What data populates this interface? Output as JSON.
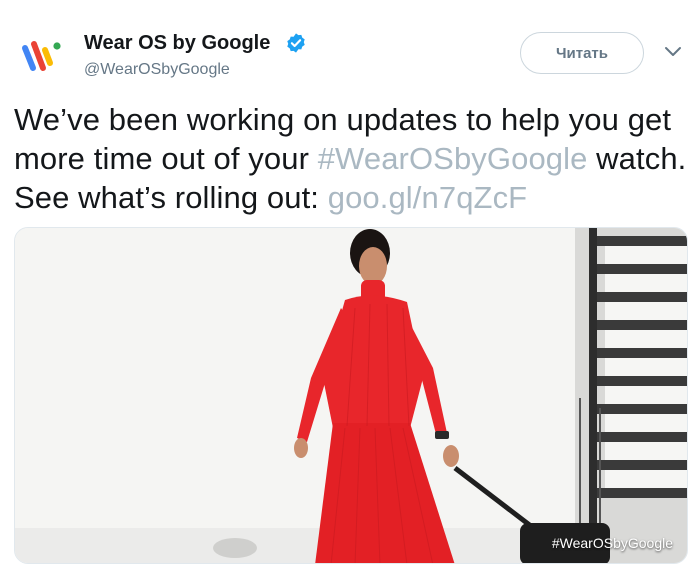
{
  "author": {
    "name": "Wear OS by Google",
    "handle": "@WearOSbyGoogle",
    "verified": true,
    "avatar_icon": "wear-os-logo"
  },
  "actions": {
    "follow_label": "Читать",
    "menu_icon": "chevron-down-icon"
  },
  "tweet": {
    "text_part1": "We’ve been working on updates to help you get more time out of your ",
    "hashtag": "#WearOSbyGoogle",
    "text_part2": " watch. See what’s rolling out: ",
    "link": "goo.gl/n7qZcF"
  },
  "media": {
    "overlay_text": "#WearOSbyGoogle"
  },
  "colors": {
    "text": "#14171a",
    "secondary": "#657786",
    "link_muted": "#aab8c2",
    "verified_blue": "#1da1f2",
    "dress_red": "#e8262b"
  }
}
